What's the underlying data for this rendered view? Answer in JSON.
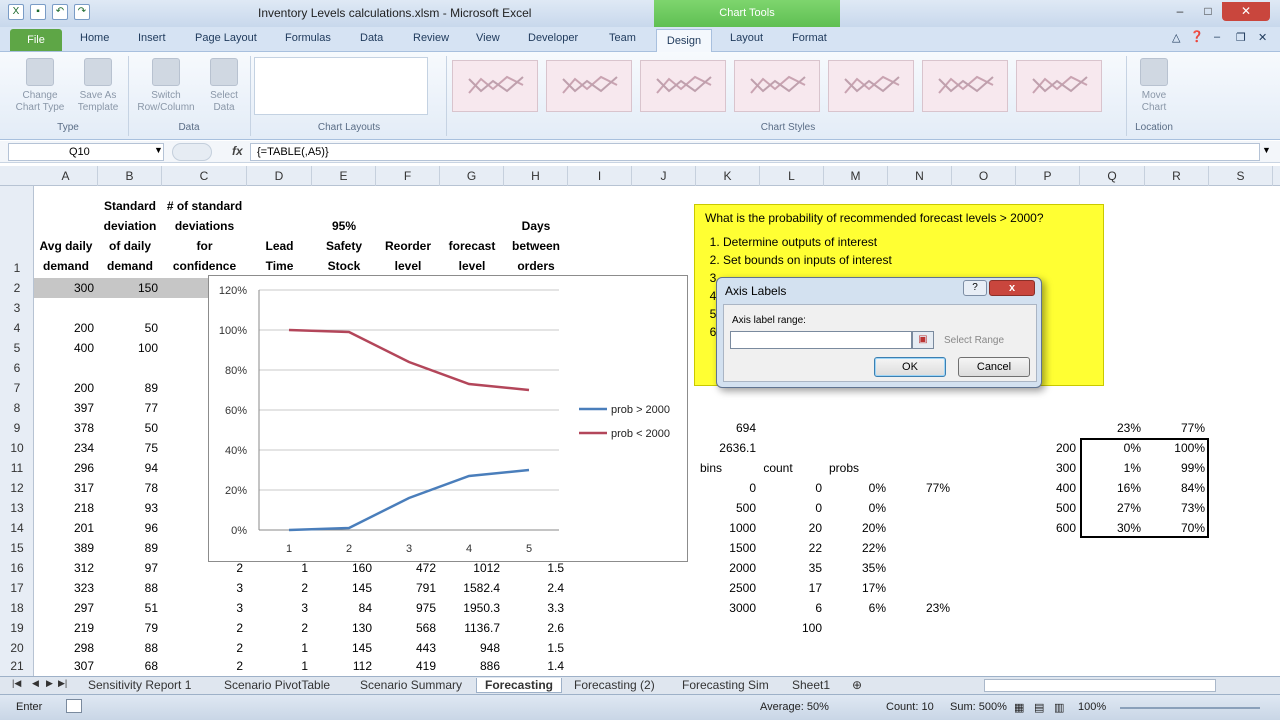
{
  "window": {
    "title": "Inventory Levels calculations.xlsm - Microsoft Excel",
    "context_tab": "Chart Tools"
  },
  "tabs": [
    "File",
    "Home",
    "Insert",
    "Page Layout",
    "Formulas",
    "Data",
    "Review",
    "View",
    "Developer",
    "Team",
    "Design",
    "Layout",
    "Format"
  ],
  "active_tab": "Design",
  "ribbon": {
    "change_chart_type": "Change Chart Type",
    "save_as_template": "Save As Template",
    "group_type": "Type",
    "switch_row_column": "Switch Row/Column",
    "select_data": "Select Data",
    "group_data": "Data",
    "group_chart_layouts": "Chart Layouts",
    "group_chart_styles": "Chart Styles",
    "move_chart": "Move Chart",
    "group_location": "Location"
  },
  "formula_bar": {
    "name_box": "Q10",
    "fx": "fx",
    "formula": "{=TABLE(,A5)}"
  },
  "columns": [
    "A",
    "B",
    "C",
    "D",
    "E",
    "F",
    "G",
    "H",
    "I",
    "J",
    "K",
    "L",
    "M",
    "N",
    "O",
    "P",
    "Q",
    "R",
    "S"
  ],
  "rows": [
    "1",
    "2",
    "3",
    "4",
    "5",
    "6",
    "7",
    "8",
    "9",
    "10",
    "11",
    "12",
    "13",
    "14",
    "15",
    "16",
    "17",
    "18",
    "19",
    "20",
    "21"
  ],
  "headers": {
    "a": [
      "Avg daily",
      "demand"
    ],
    "b": [
      "Standard",
      "deviation",
      "of daily",
      "demand"
    ],
    "c": [
      "# of standard",
      "deviations",
      "for",
      "confidence"
    ],
    "d": [
      "Lead",
      "Time"
    ],
    "e": [
      "95%",
      "Safety",
      "Stock"
    ],
    "f": [
      "Reorder",
      "level"
    ],
    "g": [
      "forecast",
      "level"
    ],
    "h": [
      "Days",
      "between",
      "orders"
    ]
  },
  "col_a": [
    "300",
    "",
    "200",
    "400",
    "",
    "200",
    "397",
    "378",
    "234",
    "296",
    "317",
    "218",
    "201",
    "389",
    "312",
    "323",
    "297",
    "219",
    "298",
    "307"
  ],
  "col_b": [
    "150",
    "",
    "50",
    "100",
    "",
    "89",
    "77",
    "50",
    "75",
    "94",
    "78",
    "93",
    "96",
    "89",
    "97",
    "88",
    "51",
    "79",
    "88",
    "68"
  ],
  "lower_rows": [
    {
      "c": "2",
      "d": "1",
      "e": "160",
      "f": "472",
      "g": "1012",
      "h": "1.5"
    },
    {
      "c": "3",
      "d": "2",
      "e": "145",
      "f": "791",
      "g": "1582.4",
      "h": "2.4"
    },
    {
      "c": "3",
      "d": "3",
      "e": "84",
      "f": "975",
      "g": "1950.3",
      "h": "3.3"
    },
    {
      "c": "2",
      "d": "2",
      "e": "130",
      "f": "568",
      "g": "1136.7",
      "h": "2.6"
    },
    {
      "c": "2",
      "d": "1",
      "e": "145",
      "f": "443",
      "g": "948",
      "h": "1.5"
    },
    {
      "c": "2",
      "d": "1",
      "e": "112",
      "f": "419",
      "g": "886",
      "h": "1.4"
    }
  ],
  "question": {
    "text": "What is the probability of recommended forecast levels > 2000?",
    "items": [
      "Determine outputs of interest",
      "Set bounds on inputs of interest",
      "",
      "",
      "",
      ""
    ]
  },
  "stats": {
    "k9": "694",
    "k10": "2636.1",
    "bins_label": "bins",
    "count_label": "count",
    "probs_label": "probs",
    "bins": [
      "0",
      "500",
      "1000",
      "1500",
      "2000",
      "2500",
      "3000"
    ],
    "counts": [
      "0",
      "0",
      "20",
      "22",
      "35",
      "17",
      "6"
    ],
    "probs": [
      "0%",
      "0%",
      "20%",
      "22%",
      "35%",
      "17%",
      "6%"
    ],
    "n12": "77%",
    "n18": "23%",
    "l19": "100"
  },
  "data_table": {
    "q9": "23%",
    "r9": "77%",
    "p": [
      "200",
      "300",
      "400",
      "500",
      "600"
    ],
    "q": [
      "0%",
      "1%",
      "16%",
      "27%",
      "30%"
    ],
    "r": [
      "100%",
      "99%",
      "84%",
      "73%",
      "70%"
    ]
  },
  "chart_data": {
    "type": "line",
    "categories": [
      "1",
      "2",
      "3",
      "4",
      "5"
    ],
    "series": [
      {
        "name": "prob > 2000",
        "values": [
          0.0,
          0.01,
          0.16,
          0.27,
          0.3
        ],
        "color": "#4a7ebb"
      },
      {
        "name": "prob < 2000",
        "values": [
          1.0,
          0.99,
          0.84,
          0.73,
          0.7
        ],
        "color": "#b3465a"
      }
    ],
    "ylim": [
      0,
      1.2
    ],
    "yticks": [
      "0%",
      "20%",
      "40%",
      "60%",
      "80%",
      "100%",
      "120%"
    ],
    "grid": true,
    "legend": "right"
  },
  "dialog": {
    "title": "Axis Labels",
    "help": "?",
    "close": "x",
    "range_label": "Axis label range:",
    "range_value": "",
    "select_range": "Select Range",
    "ok": "OK",
    "cancel": "Cancel"
  },
  "sheet_tabs": [
    "Sensitivity Report 1",
    "Scenario PivotTable",
    "Scenario Summary",
    "Forecasting",
    "Forecasting (2)",
    "Forecasting Sim",
    "Sheet1"
  ],
  "active_sheet": "Forecasting",
  "status": {
    "mode": "Enter",
    "average": "Average: 50%",
    "count": "Count: 10",
    "sum": "Sum: 500%",
    "zoom": "100%"
  }
}
